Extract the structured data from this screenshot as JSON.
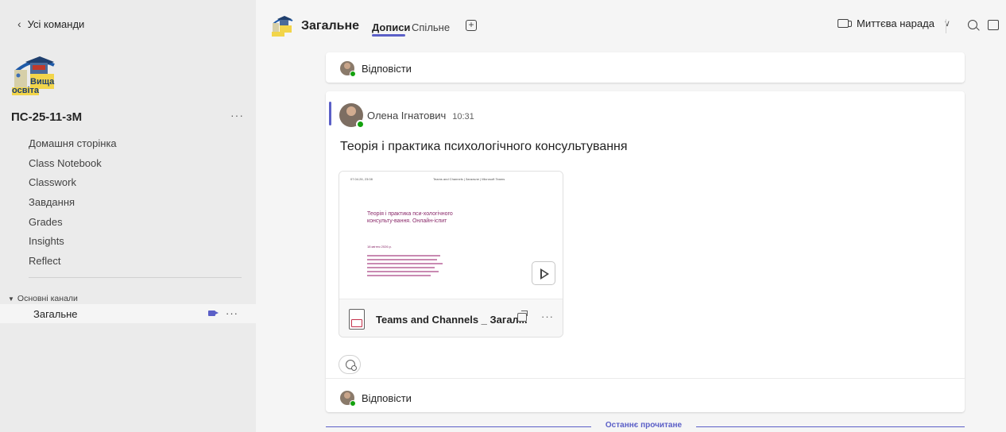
{
  "sidebar": {
    "back_label": "Усі команди",
    "team_name": "ПС-25-11-зМ",
    "team_more": "···",
    "nav_items": [
      {
        "label": "Домашня сторінка"
      },
      {
        "label": "Class Notebook"
      },
      {
        "label": "Classwork"
      },
      {
        "label": "Завдання"
      },
      {
        "label": "Grades"
      },
      {
        "label": "Insights"
      },
      {
        "label": "Reflect"
      }
    ],
    "section_label": "Основні канали",
    "channel": {
      "name": "Загальне",
      "more": "···"
    }
  },
  "header": {
    "channel_title": "Загальне",
    "tab_posts": "Дописи",
    "tab_shared": "Спільне",
    "add_tab": "+",
    "meet_label": "Миттєва нарада"
  },
  "posts": {
    "reply_label": "Відповісти",
    "message": {
      "author": "Олена Ігнатович",
      "time": "10:31",
      "title": "Теорія і практика психологічного консультування",
      "preview": {
        "top_left": "07.04.26, 23:08",
        "top_center": "Teams and Channels | Загальне | Microsoft Teams",
        "heading": "Теорія і практика пси-хологічного консульту-вання. Онлайн-іспит",
        "date": "18 квітня 2026 р."
      },
      "file_name": "Teams and Channels _ Загал..."
    },
    "reply_label_2": "Відповісти",
    "last_read_label": "Останнє прочитане"
  },
  "colors": {
    "accent": "#5b5fc7",
    "presence_available": "#13a10e",
    "file_red": "#c4314b"
  },
  "icons": {
    "back": "chevron-left-icon",
    "camera": "video-camera-icon",
    "search": "search-icon",
    "panel": "side-panel-icon",
    "play": "play-icon",
    "share": "share-icon",
    "reaction": "add-reaction-icon"
  }
}
